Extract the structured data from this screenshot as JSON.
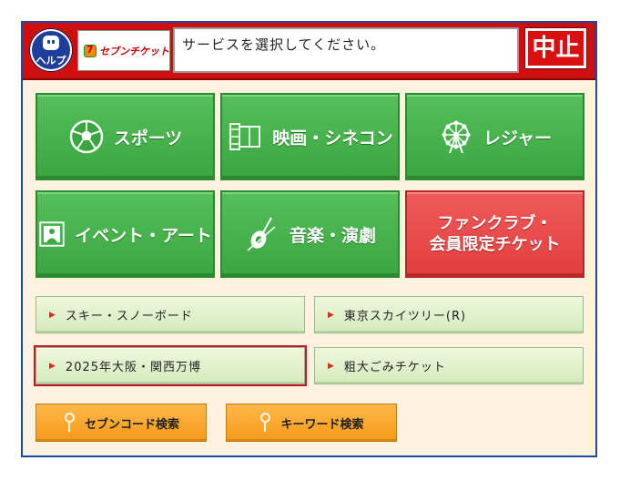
{
  "header": {
    "help_label": "ヘルプ",
    "logo_text": "セブンチケット",
    "message": "サービスを選択してください。",
    "stop_label": "中止"
  },
  "tiles": [
    {
      "label": "スポーツ",
      "icon": "soccer-ball-icon"
    },
    {
      "label": "映画・シネコン",
      "icon": "film-strip-icon"
    },
    {
      "label": "レジャー",
      "icon": "ferris-wheel-icon"
    },
    {
      "label": "イベント・アート",
      "icon": "portrait-frame-icon"
    },
    {
      "label": "音楽・演劇",
      "icon": "violin-icon"
    },
    {
      "label_line1": "ファンクラブ・",
      "label_line2": "会員限定チケット"
    }
  ],
  "small_buttons": [
    {
      "label": "スキー・スノーボード"
    },
    {
      "label": "東京スカイツリー(R)"
    },
    {
      "label": "2025年大阪・関西万博",
      "selected": true
    },
    {
      "label": "粗大ごみチケット"
    }
  ],
  "search_buttons": [
    {
      "label": "セブンコード検索",
      "icon": "search-key-icon"
    },
    {
      "label": "キーワード検索",
      "icon": "search-key-icon"
    }
  ],
  "colors": {
    "header_red": "#cc1010",
    "tile_green": "#3aa63f",
    "tile_red": "#e23e3e",
    "small_green": "#d4ebbc",
    "orange": "#f59a1a",
    "frame_blue": "#1b4aa3",
    "background": "#fff3e0"
  }
}
